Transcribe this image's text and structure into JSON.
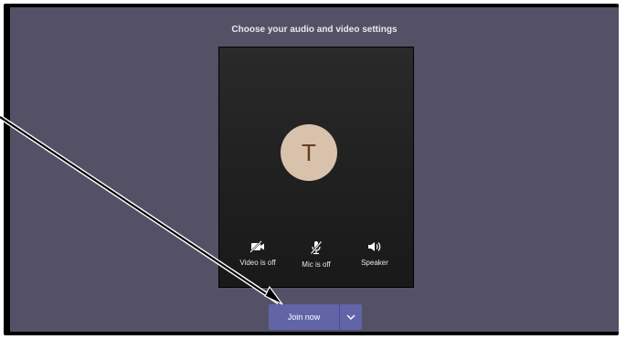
{
  "dialog": {
    "title": "Choose your audio and video settings"
  },
  "preview": {
    "avatar_initial": "T",
    "controls": [
      {
        "label": "Video is off",
        "icon": "video-off-icon"
      },
      {
        "label": "Mic is off",
        "icon": "mic-off-icon"
      },
      {
        "label": "Speaker",
        "icon": "speaker-icon"
      }
    ]
  },
  "join": {
    "label": "Join now",
    "dropdown_icon": "chevron-down-icon"
  },
  "colors": {
    "stage_bg": "#545167",
    "preview_bg": "#222222",
    "avatar_bg": "#d8c2ab",
    "avatar_text": "#6a3a1e",
    "button": "#6264a7"
  }
}
